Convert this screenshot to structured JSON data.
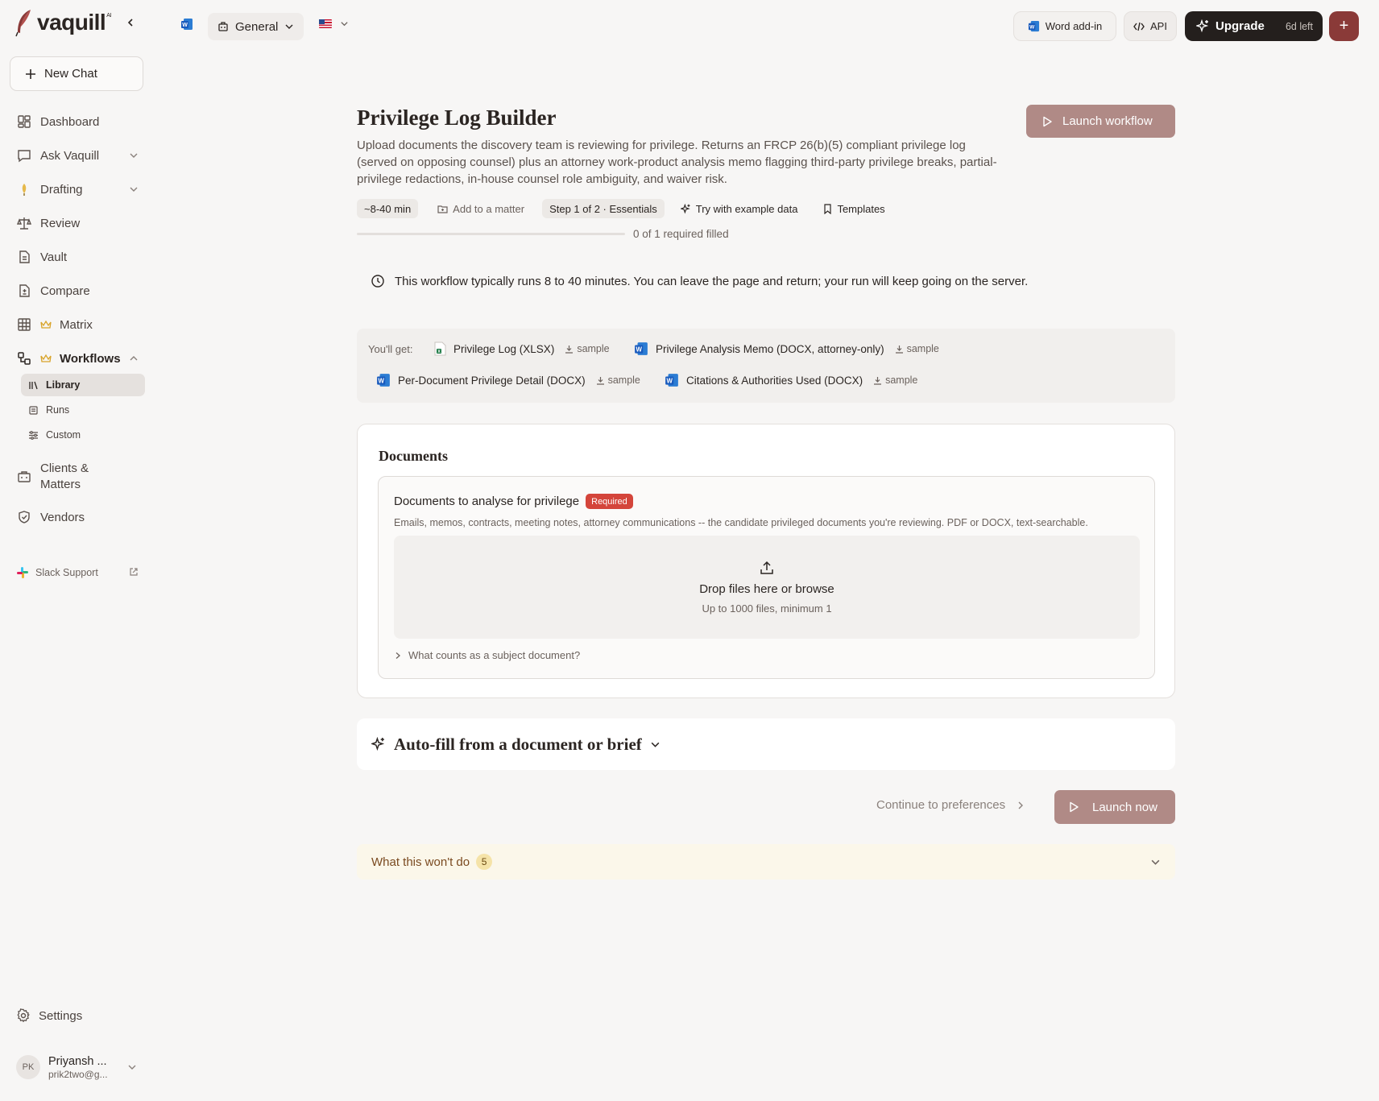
{
  "brand": {
    "name": "vaquill",
    "suffix": "AI",
    "accent": "#8a3a38"
  },
  "sidebar": {
    "new_chat": "New Chat",
    "items": [
      {
        "label": "Dashboard",
        "icon": "dashboard-icon"
      },
      {
        "label": "Ask Vaquill",
        "icon": "chat-icon"
      },
      {
        "label": "Drafting",
        "icon": "pen-icon"
      },
      {
        "label": "Review",
        "icon": "scales-icon"
      },
      {
        "label": "Vault",
        "icon": "file-icon"
      },
      {
        "label": "Compare",
        "icon": "compare-icon"
      },
      {
        "label": "Matrix",
        "icon": "grid-icon"
      },
      {
        "label": "Workflows",
        "icon": "workflow-icon"
      },
      {
        "label": "Clients & Matters",
        "icon": "briefcase-icon"
      },
      {
        "label": "Vendors",
        "icon": "shield-icon"
      }
    ],
    "sub_items": [
      {
        "label": "Library",
        "icon": "library-icon"
      },
      {
        "label": "Runs",
        "icon": "runs-icon"
      },
      {
        "label": "Custom",
        "icon": "sliders-icon"
      }
    ],
    "slack": "Slack Support",
    "settings": "Settings",
    "user": {
      "initials": "PK",
      "name": "Priyansh ...",
      "email": "prik2two@g..."
    }
  },
  "topbar": {
    "workspace": "General",
    "word_addin": "Word add-in",
    "api": "API",
    "upgrade": "Upgrade",
    "trial_left": "6d left",
    "plus": "+"
  },
  "page": {
    "title": "Privilege Log Builder",
    "launch_workflow": "Launch workflow",
    "description": "Upload documents the discovery team is reviewing for privilege. Returns an FRCP 26(b)(5) compliant privilege log (served on opposing counsel) plus an attorney work-product analysis memo flagging third-party privilege breaks, partial-privilege redactions, in-house counsel role ambiguity, and waiver risk.",
    "duration": "~8-40 min",
    "add_to_matter": "Add to a matter",
    "step": "Step 1 of 2 · Essentials",
    "try_example": "Try with example data",
    "templates": "Templates",
    "progress_text": "0 of 1 required filled",
    "progress_fraction": 0,
    "notice": "This workflow typically runs 8 to 40 minutes. You can leave the page and return; your run will keep going on the server."
  },
  "youll_get": {
    "label": "You'll get:",
    "sample_label": "sample",
    "items": [
      {
        "name": "Privilege Log (XLSX)",
        "icon": "excel-icon"
      },
      {
        "name": "Privilege Analysis Memo (DOCX, attorney-only)",
        "icon": "word-icon"
      },
      {
        "name": "Per-Document Privilege Detail (DOCX)",
        "icon": "word-icon"
      },
      {
        "name": "Citations & Authorities Used (DOCX)",
        "icon": "word-icon"
      }
    ]
  },
  "documents": {
    "section_title": "Documents",
    "field_title": "Documents to analyse for privilege",
    "required": "Required",
    "help": "Emails, memos, contracts, meeting notes, attorney communications -- the candidate privileged documents you're reviewing. PDF or DOCX, text-searchable.",
    "drop_title": "Drop files here or browse",
    "drop_sub": "Up to 1000 files, minimum 1",
    "disclosure": "What counts as a subject document?"
  },
  "autofill": {
    "title": "Auto-fill from a document or brief"
  },
  "actions": {
    "continue": "Continue to preferences",
    "launch_now": "Launch now"
  },
  "wont": {
    "title": "What this won't do",
    "count": "5"
  }
}
